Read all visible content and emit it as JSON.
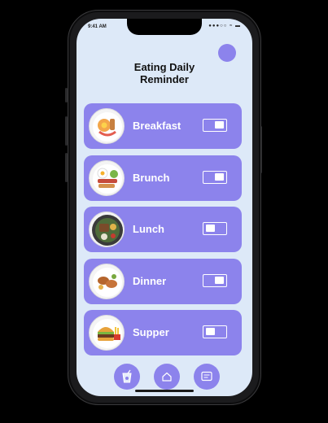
{
  "status": {
    "time": "9:41 AM",
    "icons": "●●●○○ ≈ ▬"
  },
  "header": {
    "title_line1": "Eating Daily",
    "title_line2": "Reminder"
  },
  "meals": [
    {
      "label": "Breakfast",
      "food_icon": "breakfast-plate-icon",
      "enabled": true
    },
    {
      "label": "Brunch",
      "food_icon": "brunch-plate-icon",
      "enabled": true
    },
    {
      "label": "Lunch",
      "food_icon": "lunch-plate-icon",
      "enabled": false
    },
    {
      "label": "Dinner",
      "food_icon": "dinner-plate-icon",
      "enabled": true
    },
    {
      "label": "Supper",
      "food_icon": "burger-plate-icon",
      "enabled": false
    }
  ],
  "nav": [
    {
      "icon": "drink-icon"
    },
    {
      "icon": "home-icon"
    },
    {
      "icon": "message-icon"
    }
  ],
  "colors": {
    "accent": "#8c83ec",
    "background": "#dde9f8"
  }
}
